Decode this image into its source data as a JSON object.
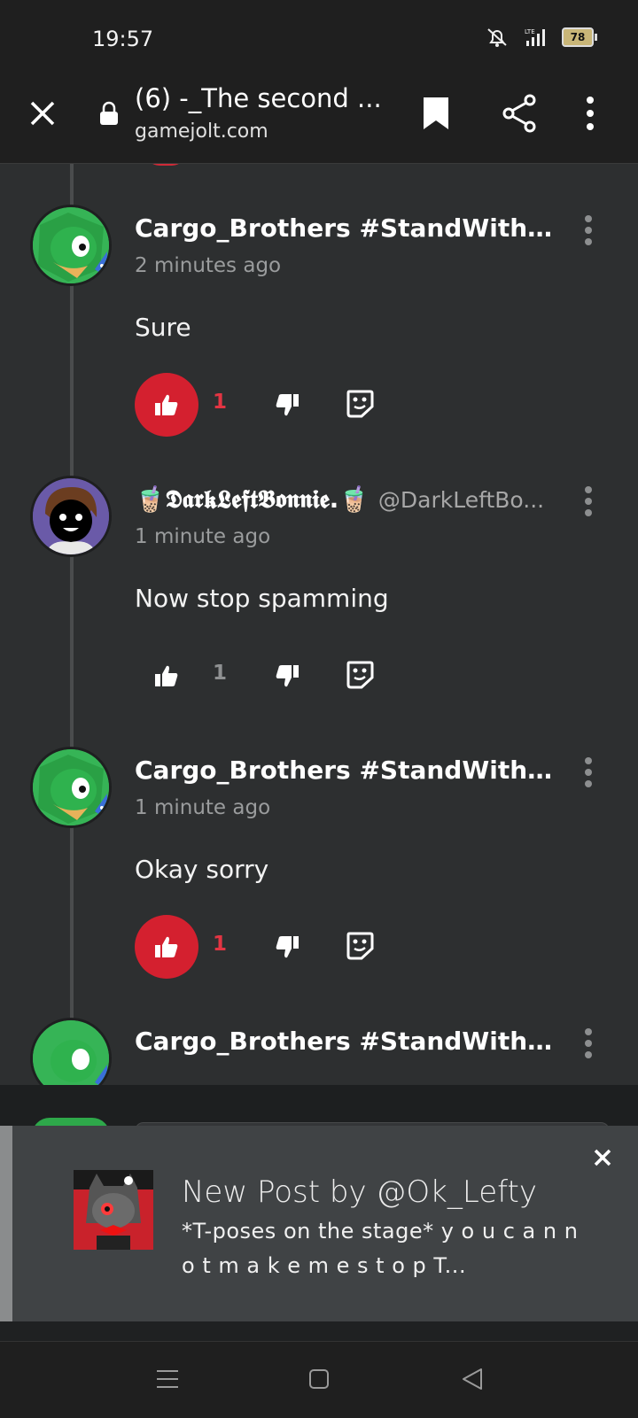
{
  "status_bar": {
    "time": "19:57",
    "battery": "78",
    "network": "LTE"
  },
  "browser": {
    "title": "(6) -_The second ...",
    "url": "gamejolt.com"
  },
  "comments": [
    {
      "username": "Cargo_Brothers #StandWithUkr...",
      "handle": "",
      "time": "2 minutes ago",
      "text": "Sure",
      "likes": "1",
      "liked": true
    },
    {
      "username": "🧋𝕯𝖆𝖗𝖐𝕷𝖊𝖋𝖙𝕭𝖔𝖓𝖓𝖎𝖊.🧋",
      "handle": "@DarkLeftBo...",
      "time": "1 minute ago",
      "text": "Now stop spamming",
      "likes": "1",
      "liked": false
    },
    {
      "username": "Cargo_Brothers #StandWithUkr...",
      "handle": "",
      "time": "1 minute ago",
      "text": "Okay sorry",
      "likes": "1",
      "liked": true
    },
    {
      "username": "Cargo_Brothers #StandWithUkr...",
      "handle": "",
      "time": "",
      "text": "",
      "likes": "",
      "liked": false
    }
  ],
  "notification": {
    "title": "New Post by @Ok_Lefty",
    "body": "*T-poses on the stage* y o u c a n n o t m a k e m e s t o p T..."
  },
  "colors": {
    "accent": "#d4202f",
    "background": "#2d2f30",
    "bar": "#1f1f1f"
  },
  "icons": [
    "close-icon",
    "lock-icon",
    "bookmark-icon",
    "share-icon",
    "more-vert-icon",
    "thumbs-up-icon",
    "thumbs-down-icon",
    "reply-sticker-icon",
    "menu-icon",
    "home-icon",
    "back-icon"
  ]
}
